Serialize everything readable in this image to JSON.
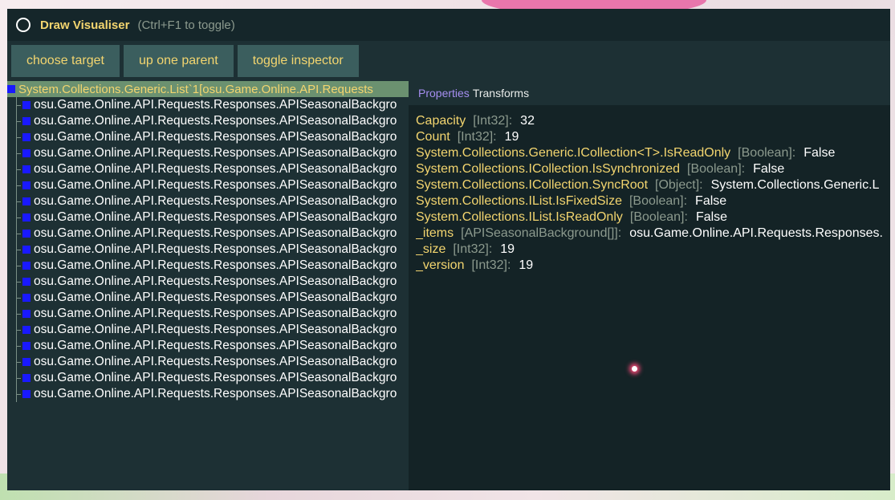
{
  "window": {
    "title": "Draw Visualiser",
    "hint": "(Ctrl+F1 to toggle)"
  },
  "toolbar": {
    "choose_target": "choose target",
    "up_one_parent": "up one parent",
    "toggle_inspector": "toggle inspector"
  },
  "tree": {
    "root_label": "System.Collections.Generic.List`1[osu.Game.Online.API.Requests",
    "items": [
      "osu.Game.Online.API.Requests.Responses.APISeasonalBackgrо",
      "osu.Game.Online.API.Requests.Responses.APISeasonalBackgrо",
      "osu.Game.Online.API.Requests.Responses.APISeasonalBackgrо",
      "osu.Game.Online.API.Requests.Responses.APISeasonalBackgrо",
      "osu.Game.Online.API.Requests.Responses.APISeasonalBackgrо",
      "osu.Game.Online.API.Requests.Responses.APISeasonalBackgrо",
      "osu.Game.Online.API.Requests.Responses.APISeasonalBackgrо",
      "osu.Game.Online.API.Requests.Responses.APISeasonalBackgrо",
      "osu.Game.Online.API.Requests.Responses.APISeasonalBackgrо",
      "osu.Game.Online.API.Requests.Responses.APISeasonalBackgrо",
      "osu.Game.Online.API.Requests.Responses.APISeasonalBackgrо",
      "osu.Game.Online.API.Requests.Responses.APISeasonalBackgrо",
      "osu.Game.Online.API.Requests.Responses.APISeasonalBackgrо",
      "osu.Game.Online.API.Requests.Responses.APISeasonalBackgrо",
      "osu.Game.Online.API.Requests.Responses.APISeasonalBackgrо",
      "osu.Game.Online.API.Requests.Responses.APISeasonalBackgrо",
      "osu.Game.Online.API.Requests.Responses.APISeasonalBackgrо",
      "osu.Game.Online.API.Requests.Responses.APISeasonalBackgrо",
      "osu.Game.Online.API.Requests.Responses.APISeasonalBackgrо"
    ]
  },
  "inspector": {
    "tab_properties": "Properties",
    "tab_transforms": "Transforms",
    "properties": [
      {
        "name": "Capacity",
        "type": "[Int32]:",
        "value": "32"
      },
      {
        "name": "Count",
        "type": "[Int32]:",
        "value": "19"
      },
      {
        "name": "System.Collections.Generic.ICollection<T>.IsReadOnly",
        "type": "[Boolean]:",
        "value": "False"
      },
      {
        "name": "System.Collections.ICollection.IsSynchronized",
        "type": "[Boolean]:",
        "value": "False"
      },
      {
        "name": "System.Collections.ICollection.SyncRoot",
        "type": "[Object]:",
        "value": "System.Collections.Generic.L"
      },
      {
        "name": "System.Collections.IList.IsFixedSize",
        "type": "[Boolean]:",
        "value": "False"
      },
      {
        "name": "System.Collections.IList.IsReadOnly",
        "type": "[Boolean]:",
        "value": "False"
      },
      {
        "name": "_items",
        "type": "[APISeasonalBackground[]]:",
        "value": "osu.Game.Online.API.Requests.Responses."
      },
      {
        "name": "_size",
        "type": "[Int32]:",
        "value": "19"
      },
      {
        "name": "_version",
        "type": "[Int32]:",
        "value": "19"
      }
    ]
  },
  "colors": {
    "accent_yellow": "#f3d56f",
    "tab_active_purple": "#a58ef0",
    "node_square_blue": "#1919ff",
    "selected_row_green": "#6b9170"
  }
}
